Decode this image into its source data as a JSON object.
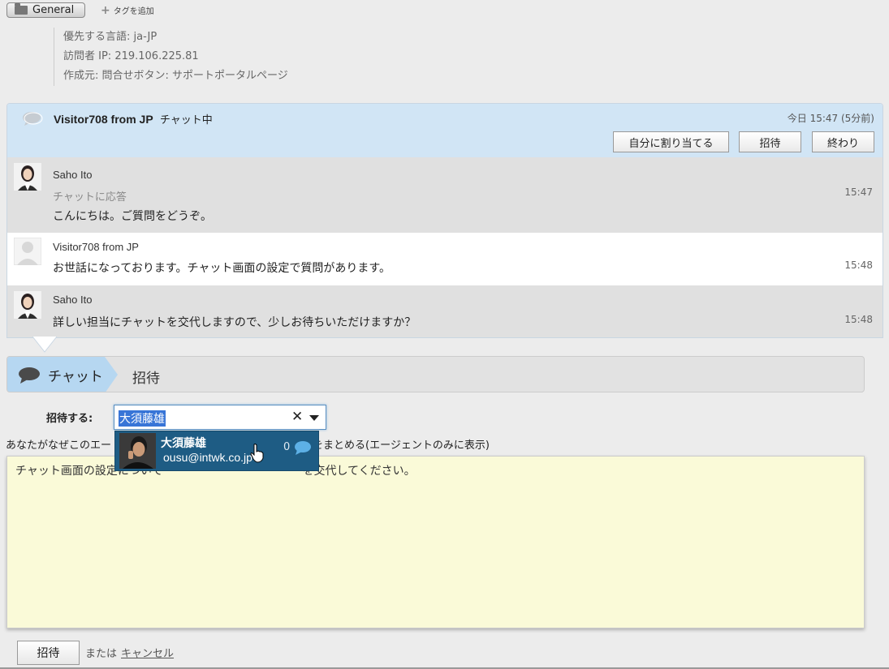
{
  "tags": {
    "group": "General",
    "add_tag": "タグを追加"
  },
  "visitor_info": {
    "language": "優先する言語: ja-JP",
    "ip": "訪問者 IP: 219.106.225.81",
    "source": "作成元: 問合せボタン: サポートポータルページ"
  },
  "chat": {
    "visitor_name": "Visitor708 from JP",
    "status": "チャット中",
    "timestamp": "今日 15:47 (5分前)",
    "buttons": {
      "assign": "自分に割り当てる",
      "invite": "招待",
      "end": "終わり"
    },
    "messages": [
      {
        "sender": "Saho Ito",
        "subtext": "チャットに応答",
        "text": "こんにちは。ご質問をどうぞ。",
        "time": "15:47",
        "type": "agent"
      },
      {
        "sender": "Visitor708 from JP",
        "subtext": "",
        "text": "お世話になっております。チャット画面の設定で質問があります。",
        "time": "15:48",
        "type": "visitor"
      },
      {
        "sender": "Saho Ito",
        "subtext": "",
        "text": "詳しい担当にチャットを交代しますので、少しお待ちいただけますか？",
        "time": "15:48",
        "type": "agent"
      }
    ]
  },
  "tabs": {
    "chat": "チャット",
    "invite": "招待"
  },
  "invite_form": {
    "label": "招待する:",
    "selected": "大須藤雄",
    "reason_label_left": "あなたがなぜこのエー",
    "reason_label_right": "をまとめる(エージェントのみに表示)",
    "dropdown": {
      "name": "大須藤雄",
      "email": "ousu@intwk.co.jp",
      "chat_count": "0"
    },
    "notes_visible": "チャット画面の設定について",
    "notes_tail": "を交代してください。",
    "submit": "招待",
    "or": "または",
    "cancel": "キャンセル"
  },
  "colors": {
    "header_bg": "#d1e5f5",
    "tab_active": "#b6d7f1",
    "dropdown_bg": "#1e5c84",
    "notes_bg": "#fafad8"
  }
}
